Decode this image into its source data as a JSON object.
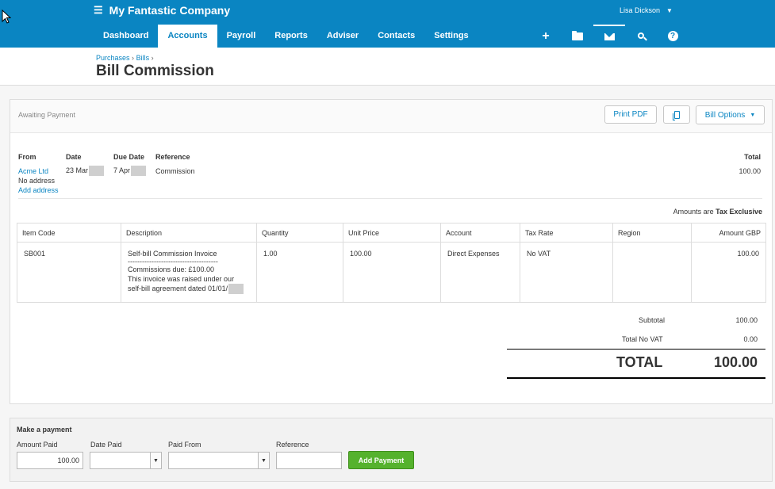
{
  "topbar": {
    "company": "My Fantastic Company",
    "user": "Lisa Dickson",
    "tabs": [
      "Dashboard",
      "Accounts",
      "Payroll",
      "Reports",
      "Adviser",
      "Contacts",
      "Settings"
    ],
    "active_tab": "Accounts",
    "icons": [
      "add-icon",
      "folder-icon",
      "mail-icon",
      "search-icon",
      "help-icon"
    ],
    "colors": {
      "brand": "#0a85c2"
    }
  },
  "breadcrumb": {
    "purchases": "Purchases",
    "bills": "Bills"
  },
  "page_title": "Bill Commission",
  "bill": {
    "status": "Awaiting Payment",
    "buttons": {
      "print": "Print PDF",
      "options": "Bill Options"
    },
    "headers": {
      "from": "From",
      "date": "Date",
      "due_date": "Due Date",
      "reference": "Reference",
      "total": "Total"
    },
    "from": "Acme Ltd",
    "no_address": "No address",
    "add_address": "Add address",
    "date": "23 Mar",
    "due_date": "7 Apr",
    "reference": "Commission",
    "total": "100.00",
    "amounts_prefix": "Amounts are",
    "amounts_mode": "Tax Exclusive",
    "columns": [
      "Item Code",
      "Description",
      "Quantity",
      "Unit Price",
      "Account",
      "Tax Rate",
      "Region",
      "Amount GBP"
    ],
    "line": {
      "item_code": "SB001",
      "desc_1": "Self-bill Commission Invoice",
      "desc_2": "--------------------------------------",
      "desc_3": "Commissions due: £100.00",
      "desc_4": "This invoice was raised under our",
      "desc_5": "self-bill agreement dated 01/01/",
      "quantity": "1.00",
      "unit_price": "100.00",
      "account": "Direct Expenses",
      "tax_rate": "No VAT",
      "region": "",
      "amount": "100.00"
    },
    "subtotal_label": "Subtotal",
    "subtotal": "100.00",
    "tax_label": "Total No VAT",
    "tax": "0.00",
    "total_label": "TOTAL",
    "grand_total": "100.00"
  },
  "payment": {
    "title": "Make a payment",
    "amount_label": "Amount Paid",
    "amount": "100.00",
    "date_label": "Date Paid",
    "from_label": "Paid From",
    "reference_label": "Reference",
    "button": "Add Payment",
    "colors": {
      "button": "#55b22d"
    }
  }
}
